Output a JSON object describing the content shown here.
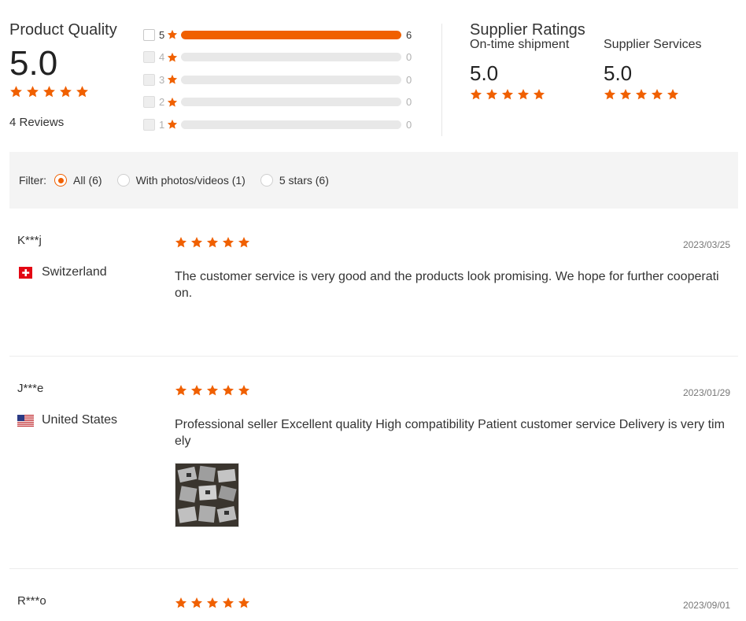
{
  "product_quality": {
    "title": "Product Quality",
    "score": "5.0",
    "stars": 5,
    "reviews_label": "4 Reviews"
  },
  "histogram": [
    {
      "stars": "5",
      "count": "6",
      "fraction": 1.0
    },
    {
      "stars": "4",
      "count": "0",
      "fraction": 0
    },
    {
      "stars": "3",
      "count": "0",
      "fraction": 0
    },
    {
      "stars": "2",
      "count": "0",
      "fraction": 0
    },
    {
      "stars": "1",
      "count": "0",
      "fraction": 0
    }
  ],
  "supplier_ratings": {
    "title": "Supplier Ratings",
    "on_time": {
      "label": "On-time shipment",
      "score": "5.0",
      "stars": 5
    },
    "services": {
      "label": "Supplier Services",
      "score": "5.0",
      "stars": 5
    }
  },
  "filter": {
    "label": "Filter:",
    "options": [
      {
        "label": "All (6)",
        "selected": true
      },
      {
        "label": "With photos/videos (1)",
        "selected": false
      },
      {
        "label": "5 stars (6)",
        "selected": false
      }
    ]
  },
  "reviews": [
    {
      "name": "K***j",
      "country": "Switzerland",
      "flag": "swiss-flag-icon",
      "stars": 5,
      "date": "2023/03/25",
      "text": "The customer service is very good and the products look promising. We hope for further cooperation."
    },
    {
      "name": "J***e",
      "country": "United States",
      "flag": "us-flag-icon",
      "stars": 5,
      "date": "2023/01/29",
      "text": "Professional seller Excellent quality High compatibility Patient customer service Delivery is very timely",
      "has_photo": true
    },
    {
      "name": "R***o",
      "stars": 5,
      "date": "2023/09/01"
    }
  ],
  "colors": {
    "accent": "#f06000",
    "filter_bg": "#f4f4f4",
    "bar_bg": "#e8e8e8"
  }
}
